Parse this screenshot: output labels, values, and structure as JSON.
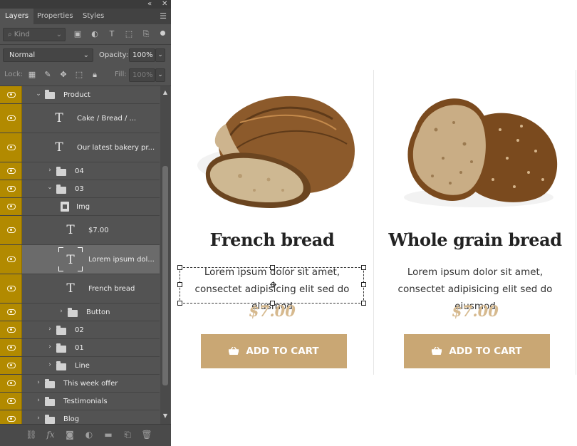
{
  "panel": {
    "tabs": [
      {
        "label": "Layers",
        "active": true
      },
      {
        "label": "Properties",
        "active": false
      },
      {
        "label": "Styles",
        "active": false
      }
    ],
    "filter": {
      "placeholder": "Kind",
      "icons": [
        "image-filter-icon",
        "adjustment-filter-icon",
        "type-filter-icon",
        "shape-filter-icon",
        "smart-object-filter-icon"
      ]
    },
    "blend_mode": "Normal",
    "opacity_label": "Opacity:",
    "opacity_value": "100%",
    "lock_label": "Lock:",
    "fill_label": "Fill:",
    "fill_value": "100%",
    "layers": [
      {
        "name": "Product",
        "type": "group",
        "expanded": true
      },
      {
        "name": "Cake   /   Bread   /   ...",
        "type": "text"
      },
      {
        "name": "Our latest bakery pr...",
        "type": "text"
      },
      {
        "name": "04",
        "type": "group",
        "expanded": false
      },
      {
        "name": "03",
        "type": "group",
        "expanded": true
      },
      {
        "name": "Img",
        "type": "smart-object"
      },
      {
        "name": "$7.00",
        "type": "text"
      },
      {
        "name": "Lorem ipsum dol...",
        "type": "text",
        "selected": true
      },
      {
        "name": "French bread",
        "type": "text"
      },
      {
        "name": "Button",
        "type": "group",
        "expanded": false
      },
      {
        "name": "02",
        "type": "group",
        "expanded": false
      },
      {
        "name": "01",
        "type": "group",
        "expanded": false
      },
      {
        "name": "Line",
        "type": "group",
        "expanded": false
      },
      {
        "name": "This week offer",
        "type": "group",
        "expanded": false
      },
      {
        "name": "Testimonials",
        "type": "group",
        "expanded": false
      },
      {
        "name": "Blog",
        "type": "group",
        "expanded": false
      }
    ],
    "bottom_icons": [
      "link-layers-icon",
      "fx-icon",
      "layer-mask-icon",
      "adjustment-layer-icon",
      "new-group-icon",
      "new-layer-icon",
      "delete-layer-icon"
    ],
    "accent_color": "#b28a00"
  },
  "products": [
    {
      "title": "French bread",
      "description": "Lorem ipsum dolor sit amet, consectet adipisicing elit sed do eiusmod",
      "price": "$7.00",
      "button": "ADD TO CART"
    },
    {
      "title": "Whole grain bread",
      "description": "Lorem ipsum dolor sit amet, consectet adipisicing elit sed do eiusmod",
      "price": "$7.00",
      "button": "ADD TO CART"
    }
  ],
  "colors": {
    "button": "#c9a774",
    "price": "#d6b98e",
    "title": "#222222"
  }
}
